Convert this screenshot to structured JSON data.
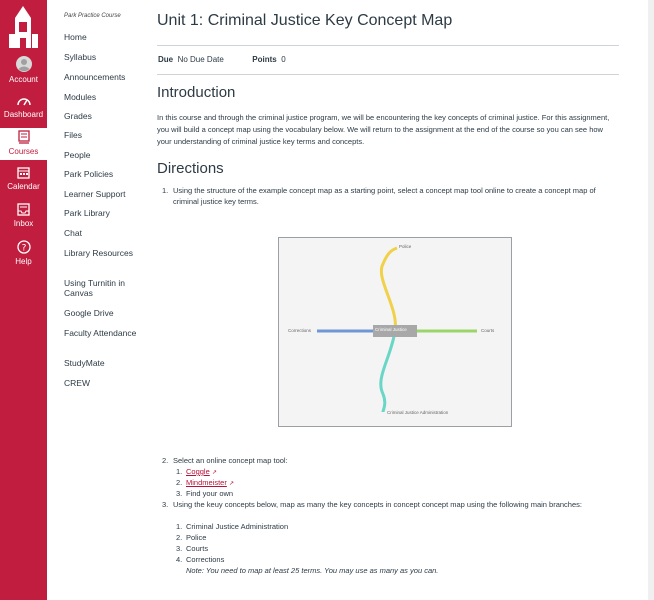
{
  "global_nav": {
    "items": [
      {
        "label": "Account",
        "icon": "avatar-icon"
      },
      {
        "label": "Dashboard",
        "icon": "dashboard-icon"
      },
      {
        "label": "Courses",
        "icon": "courses-icon"
      },
      {
        "label": "Calendar",
        "icon": "calendar-icon"
      },
      {
        "label": "Inbox",
        "icon": "inbox-icon"
      },
      {
        "label": "Help",
        "icon": "help-icon"
      }
    ],
    "accent": "#c01d3f"
  },
  "course_nav": {
    "course_name": "Park Practice Course",
    "items": [
      "Home",
      "Syllabus",
      "Announcements",
      "Modules",
      "Grades",
      "Files",
      "People",
      "Park Policies",
      "Learner Support",
      "Park Library",
      "Chat",
      "Library Resources",
      "Using Turnitin in Canvas",
      "Google Drive",
      "Faculty Attendance",
      "StudyMate",
      "CREW"
    ]
  },
  "main": {
    "title": "Unit 1: Criminal Justice Key Concept Map",
    "due_label": "Due",
    "due_value": "No Due Date",
    "points_label": "Points",
    "points_value": "0",
    "intro_heading": "Introduction",
    "intro_text": "In this course and through the criminal justice program, we will be encountering the key concepts of criminal justice. For this assignment, you will build a concept map using the vocabulary below. We will return to the assignment at the end of the course so you can see how your understanding of criminal justice key terms and concepts.",
    "directions_heading": "Directions",
    "step1_num": "1.",
    "step1_text": "Using the structure of the example concept map as a starting point, select a concept map tool online to create a concept map of criminal justice key terms.",
    "step2_num": "2.",
    "step2_text": "Select an online concept map tool:",
    "tools": [
      {
        "num": "1.",
        "label": "Coggle",
        "link": true
      },
      {
        "num": "2.",
        "label": "Mindmeister",
        "link": true
      },
      {
        "num": "3.",
        "label": "Find your own",
        "link": false
      }
    ],
    "step3_num": "3.",
    "step3_text": "Using the keuy concepts below, map as many the key concepts in concept concept map using the following main branches:",
    "branches": [
      {
        "num": "1.",
        "label": "Criminal Justice Administration"
      },
      {
        "num": "2.",
        "label": "Police"
      },
      {
        "num": "3.",
        "label": "Courts"
      },
      {
        "num": "4.",
        "label": "Corrections"
      }
    ],
    "note": "Note: You need to map at least 25 terms. You may use as many as you can."
  },
  "concept_map": {
    "center": "Criminal Justice",
    "top": "Police",
    "right": "Courts",
    "left": "Corrections",
    "bottom": "Criminal Justice Administration",
    "colors": {
      "top": "#f0d14a",
      "right": "#9bd56a",
      "left": "#6f97d4",
      "bottom": "#69d6c6",
      "center": "#a8a8a8"
    }
  }
}
